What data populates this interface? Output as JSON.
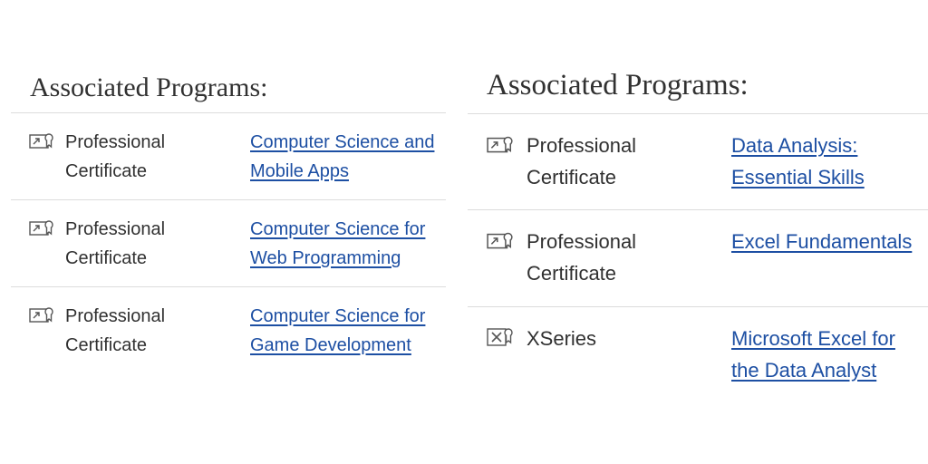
{
  "left": {
    "heading": "Associated Programs:",
    "programs": [
      {
        "icon": "professional-certificate-icon",
        "type": "Professional Certificate",
        "title": "Computer Science and Mobile Apps"
      },
      {
        "icon": "professional-certificate-icon",
        "type": "Professional Certificate",
        "title": "Computer Science for Web Programming"
      },
      {
        "icon": "professional-certificate-icon",
        "type": "Professional Certificate",
        "title": "Computer Science for Game Development"
      }
    ]
  },
  "right": {
    "heading": "Associated Programs:",
    "programs": [
      {
        "icon": "professional-certificate-icon",
        "type": "Professional Certificate",
        "title": "Data Analysis: Essential Skills"
      },
      {
        "icon": "professional-certificate-icon",
        "type": "Professional Certificate",
        "title": "Excel Fundamentals"
      },
      {
        "icon": "xseries-icon",
        "type": "XSeries",
        "title": "Microsoft Excel for the Data Analyst"
      }
    ]
  },
  "colors": {
    "text": "#313131",
    "link": "#1d4fa3",
    "divider": "#dcdcdc",
    "icon": "#555555"
  }
}
